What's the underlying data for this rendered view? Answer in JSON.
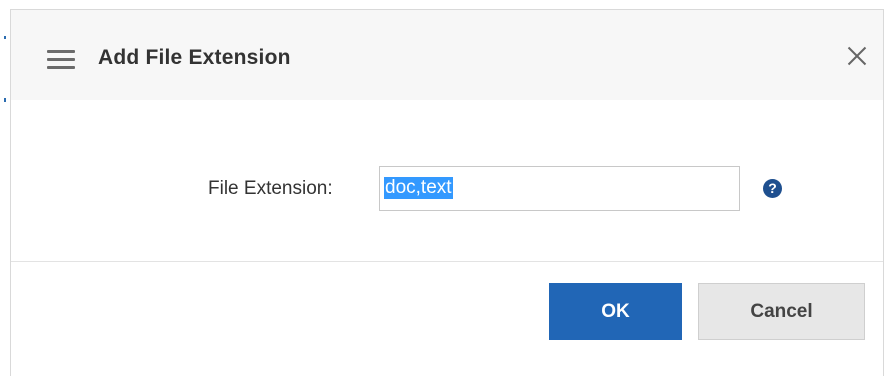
{
  "dialog": {
    "title": "Add File Extension",
    "menu_icon": "hamburger-menu-icon",
    "close_icon": "close-icon"
  },
  "form": {
    "field_label": "File Extension:",
    "field_value": "doc,text",
    "help_icon": "question-circle-icon",
    "help_glyph": "?"
  },
  "buttons": {
    "ok_label": "OK",
    "cancel_label": "Cancel"
  },
  "colors": {
    "primary": "#2166b6",
    "selection": "#3399ff",
    "help_icon": "#1e4f8f"
  }
}
